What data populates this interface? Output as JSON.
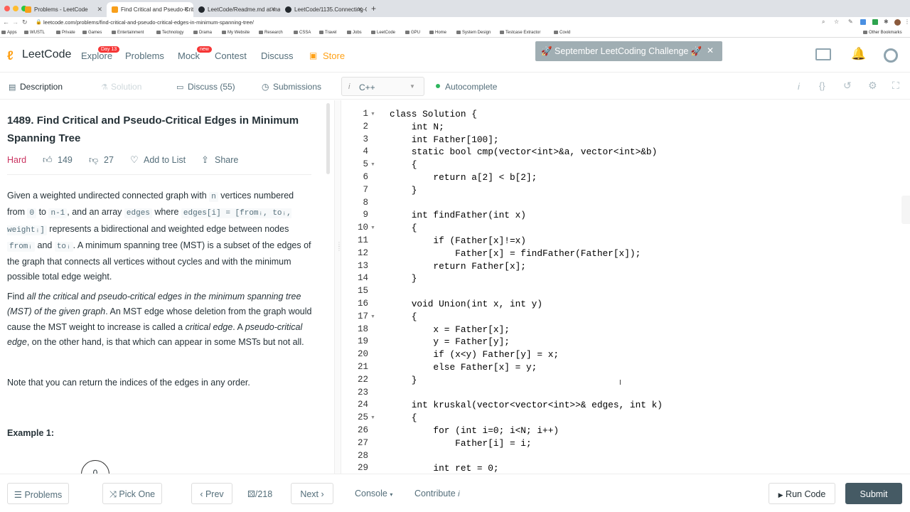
{
  "browser": {
    "tabs": [
      {
        "title": "Problems - LeetCode",
        "fav": "#f89f1b"
      },
      {
        "title": "Find Critical and Pseudo-Critic",
        "fav": "#f89f1b"
      },
      {
        "title": "LeetCode/Readme.md at mas",
        "fav": "#24292e"
      },
      {
        "title": "LeetCode/1135.Connecting-Ci",
        "fav": "#24292e"
      }
    ],
    "new_tab": "+",
    "url": "leetcode.com/problems/find-critical-and-pseudo-critical-edges-in-minimum-spanning-tree/",
    "bookmarks": [
      "Apps",
      "WUSTL",
      "Private",
      "Games",
      "Entertainment",
      "Technology",
      "Drama",
      "My Website",
      "Research",
      "CSSA",
      "Travel",
      "Jobs",
      "LeetCode",
      "GPU",
      "Home",
      "System Design",
      "Testcase Extractor",
      "Covid"
    ],
    "other_bookmarks": "Other Bookmarks"
  },
  "nav": {
    "brand": "LeetCode",
    "explore": "Explore",
    "explore_badge": "Day 13",
    "problems": "Problems",
    "mock": "Mock",
    "mock_badge": "new",
    "contest": "Contest",
    "discuss": "Discuss",
    "store": "Store",
    "banner": "🚀 September LeetCoding Challenge 🚀",
    "accent": "#ffa116"
  },
  "subtabs": {
    "description": "Description",
    "solution": "Solution",
    "discuss": "Discuss (55)",
    "submissions": "Submissions",
    "language": "C++",
    "autocomplete": "Autocomplete"
  },
  "problem": {
    "title": "1489. Find Critical and Pseudo-Critical Edges in Minimum Spanning Tree",
    "difficulty": "Hard",
    "likes": "149",
    "dislikes": "27",
    "add_to_list": "Add to List",
    "share": "Share",
    "p1_a": "Given a weighted undirected connected graph with ",
    "p1_n": "n",
    "p1_b": " vertices numbered from ",
    "p1_0": "0",
    "p1_c": " to ",
    "p1_n1": "n-1",
    "p1_d": ", and an array ",
    "p1_edges": "edges",
    "p1_e": " where ",
    "p1_edgesi": "edges[i] = [fromᵢ, toᵢ, weightᵢ]",
    "p1_f": " represents a bidirectional and weighted edge between nodes ",
    "p1_from": "fromᵢ",
    "p1_g": " and ",
    "p1_to": "toᵢ",
    "p1_h": ". A minimum spanning tree (MST) is a subset of the edges of the graph that connects all vertices without cycles and with the minimum possible total edge weight.",
    "p2_a": "Find ",
    "p2_em": "all the critical and pseudo-critical edges in the minimum spanning tree (MST) of the given graph",
    "p2_b": ". An MST edge whose deletion from the graph would cause the MST weight to increase is called a ",
    "p2_em2": "critical edge",
    "p2_c": ". A ",
    "p2_em3": "pseudo-critical edge",
    "p2_d": ", on the other hand, is that which can appear in some MSTs but not all.",
    "p3": "Note that you can return the indices of the edges in any order.",
    "example": "Example 1:",
    "graph_node": "0"
  },
  "code_lines": [
    "class Solution {",
    "    int N;",
    "    int Father[100];",
    "    static bool cmp(vector<int>&a, vector<int>&b)",
    "    {",
    "        return a[2] < b[2];",
    "    }",
    "",
    "    int findFather(int x)",
    "    {",
    "        if (Father[x]!=x)",
    "            Father[x] = findFather(Father[x]);",
    "        return Father[x];",
    "    }",
    "",
    "    void Union(int x, int y)",
    "    {",
    "        x = Father[x];",
    "        y = Father[y];",
    "        if (x<y) Father[y] = x;",
    "        else Father[x] = y;",
    "    }",
    "",
    "    int kruskal(vector<vector<int>>& edges, int k)",
    "    {",
    "        for (int i=0; i<N; i++)",
    "            Father[i] = i;",
    "",
    "        int ret = 0;"
  ],
  "line_numbers": [
    "1",
    "2",
    "3",
    "4",
    "5",
    "6",
    "7",
    "8",
    "9",
    "10",
    "11",
    "12",
    "13",
    "14",
    "15",
    "16",
    "17",
    "18",
    "19",
    "20",
    "21",
    "22",
    "23",
    "24",
    "25",
    "26",
    "27",
    "28",
    "29"
  ],
  "footer": {
    "problems": "Problems",
    "pick_one": "Pick One",
    "prev": "Prev",
    "page": "/218",
    "next": "Next",
    "console": "Console",
    "contribute": "Contribute",
    "run_code": "Run Code",
    "submit": "Submit",
    "submit_color": "#455a64"
  }
}
